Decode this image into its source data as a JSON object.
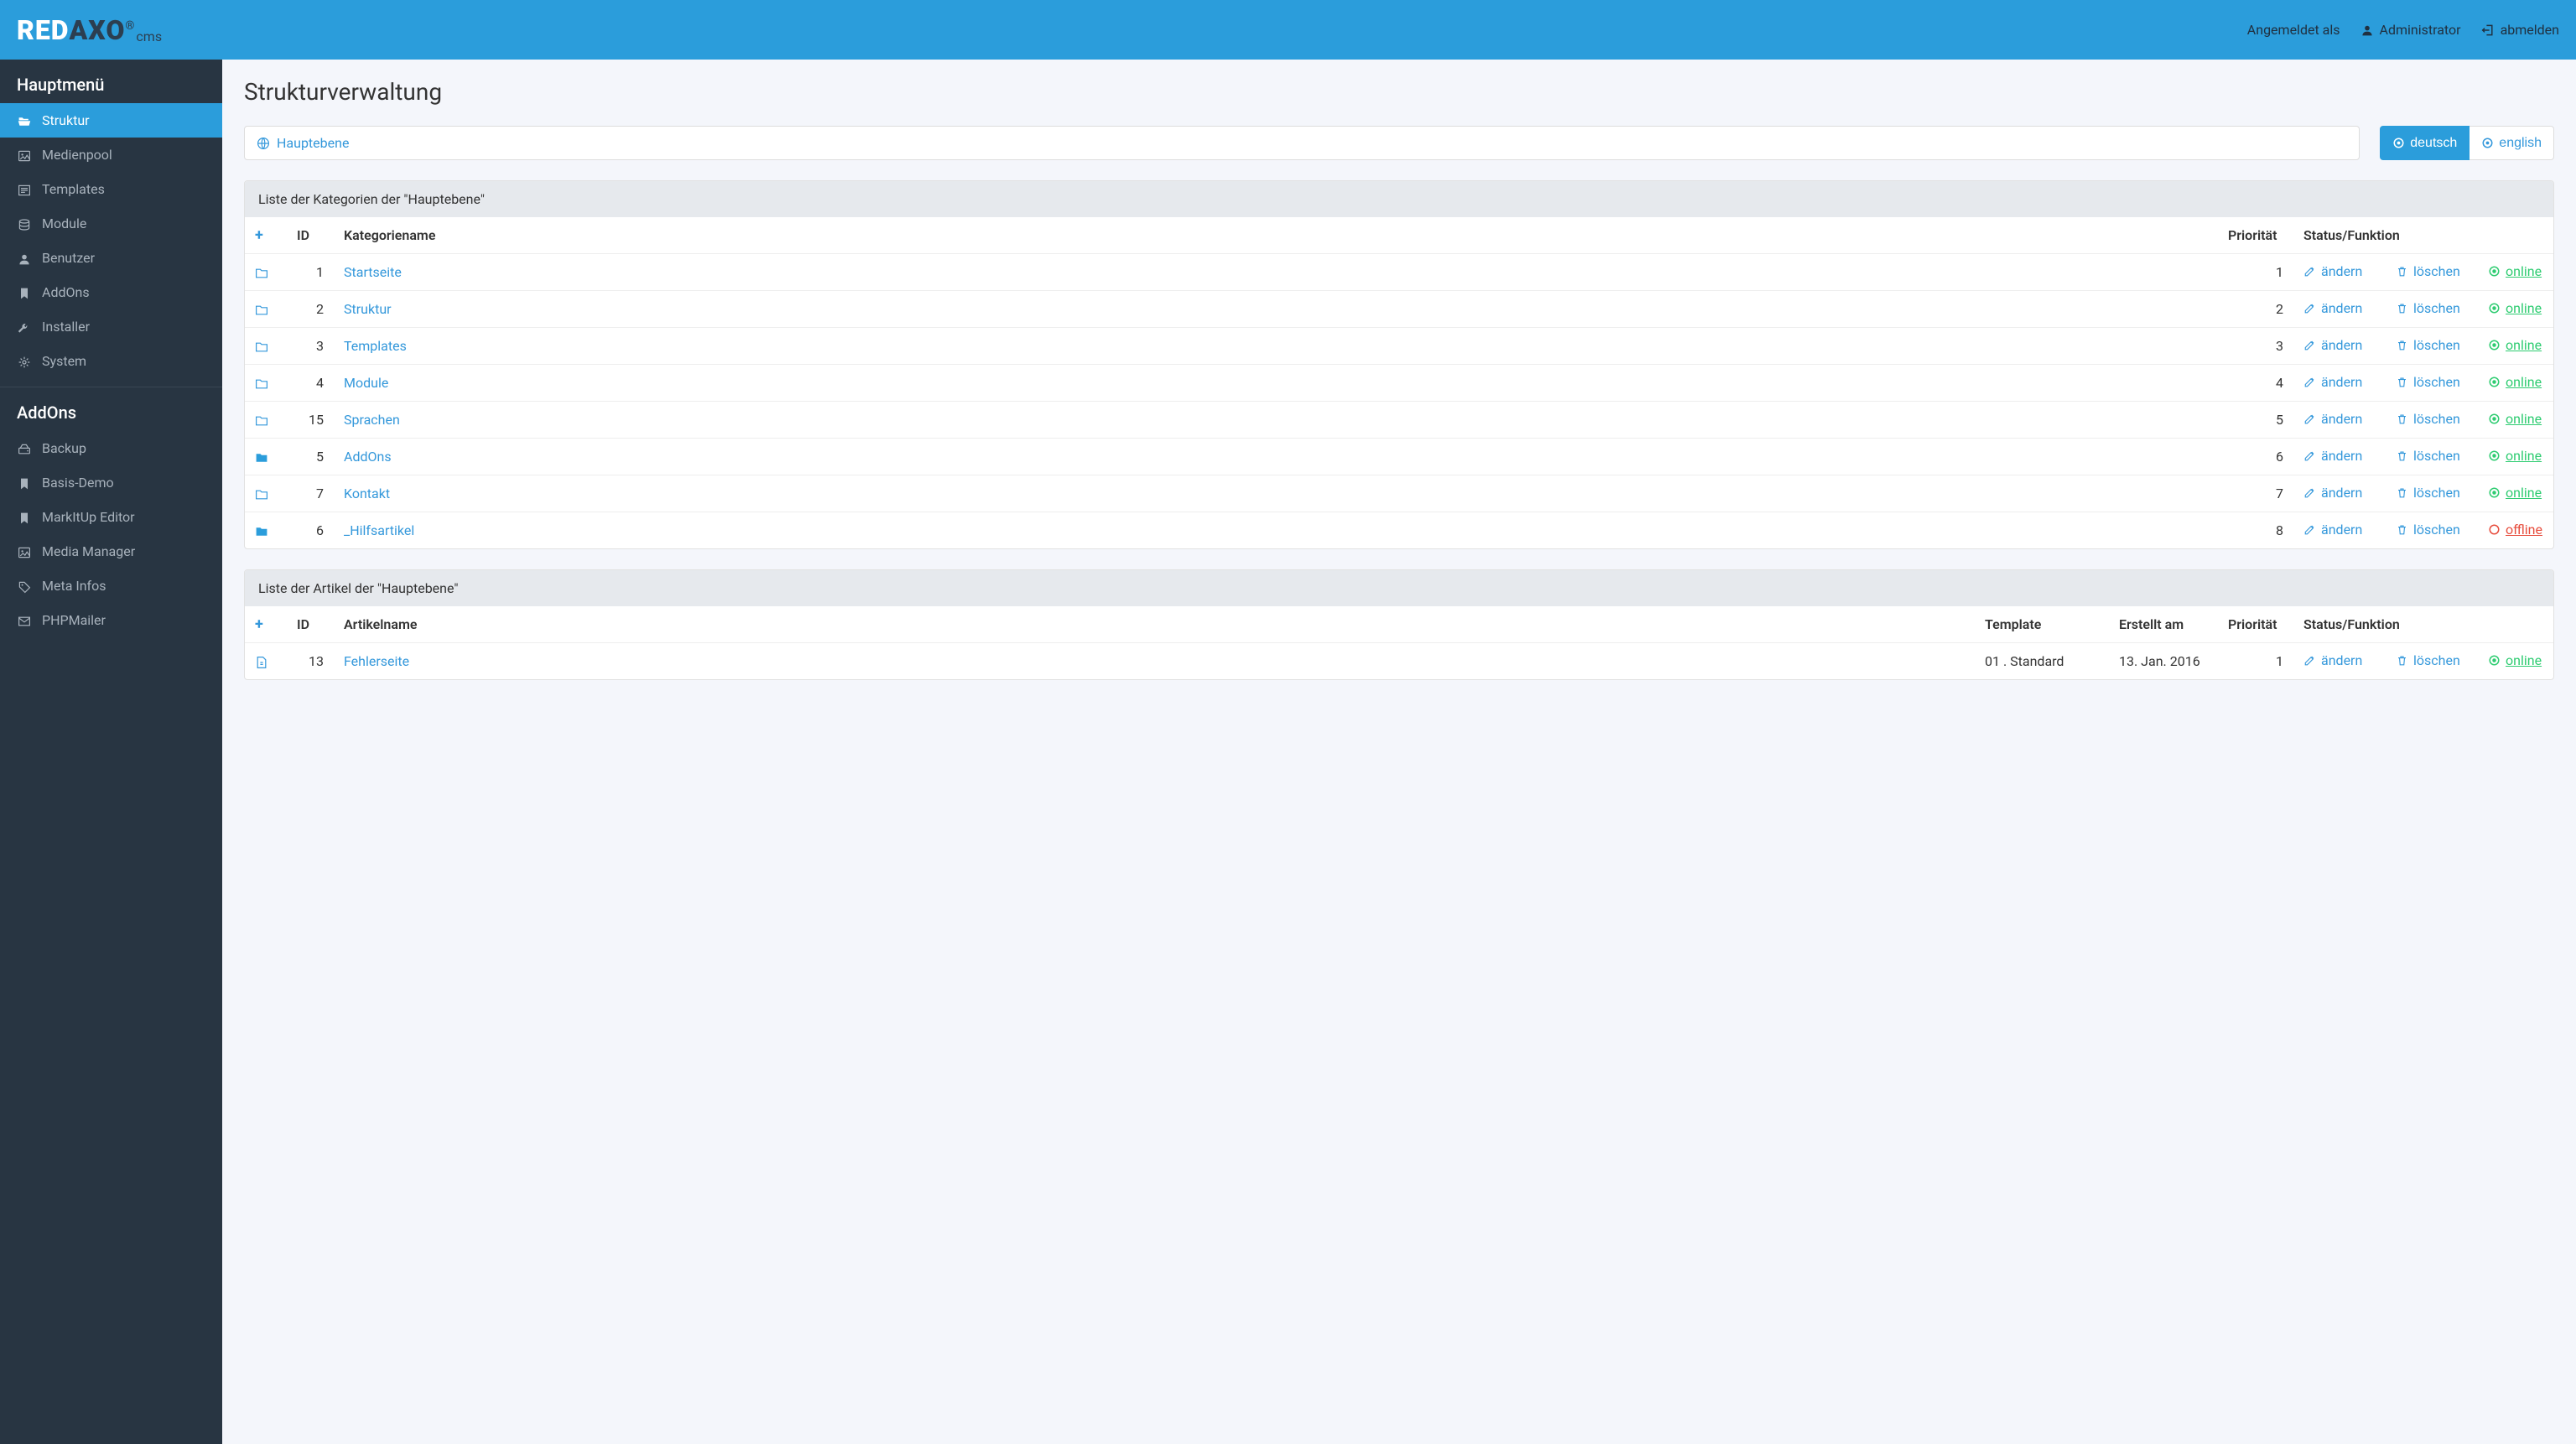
{
  "header": {
    "loggedInAs": "Angemeldet als",
    "user": "Administrator",
    "logout": "abmelden"
  },
  "sidebar": {
    "mainTitle": "Hauptmenü",
    "addonsTitle": "AddOns",
    "mainItems": [
      {
        "label": "Struktur",
        "icon": "folder-open",
        "active": true
      },
      {
        "label": "Medienpool",
        "icon": "image"
      },
      {
        "label": "Templates",
        "icon": "newspaper"
      },
      {
        "label": "Module",
        "icon": "database"
      },
      {
        "label": "Benutzer",
        "icon": "user"
      },
      {
        "label": "AddOns",
        "icon": "bookmark"
      },
      {
        "label": "Installer",
        "icon": "wrench"
      },
      {
        "label": "System",
        "icon": "cogs"
      }
    ],
    "addonItems": [
      {
        "label": "Backup",
        "icon": "hdd"
      },
      {
        "label": "Basis-Demo",
        "icon": "bookmark"
      },
      {
        "label": "MarkItUp Editor",
        "icon": "bookmark"
      },
      {
        "label": "Media Manager",
        "icon": "image"
      },
      {
        "label": "Meta Infos",
        "icon": "tag"
      },
      {
        "label": "PHPMailer",
        "icon": "envelope"
      }
    ]
  },
  "page": {
    "title": "Strukturverwaltung",
    "breadcrumb": "Hauptebene",
    "langs": [
      {
        "label": "deutsch",
        "active": true
      },
      {
        "label": "english",
        "active": false
      }
    ]
  },
  "categories": {
    "panelTitle": "Liste der Kategorien der \"Hauptebene\"",
    "headers": {
      "id": "ID",
      "name": "Kategoriename",
      "prio": "Priorität",
      "status": "Status/Funktion"
    },
    "actions": {
      "edit": "ändern",
      "delete": "löschen",
      "online": "online",
      "offline": "offline"
    },
    "rows": [
      {
        "id": 1,
        "name": "Startseite",
        "prio": 1,
        "status": "online",
        "solid": false
      },
      {
        "id": 2,
        "name": "Struktur",
        "prio": 2,
        "status": "online",
        "solid": false
      },
      {
        "id": 3,
        "name": "Templates",
        "prio": 3,
        "status": "online",
        "solid": false
      },
      {
        "id": 4,
        "name": "Module",
        "prio": 4,
        "status": "online",
        "solid": false
      },
      {
        "id": 15,
        "name": "Sprachen",
        "prio": 5,
        "status": "online",
        "solid": false
      },
      {
        "id": 5,
        "name": "AddOns",
        "prio": 6,
        "status": "online",
        "solid": true
      },
      {
        "id": 7,
        "name": "Kontakt",
        "prio": 7,
        "status": "online",
        "solid": false
      },
      {
        "id": 6,
        "name": "_Hilfsartikel",
        "prio": 8,
        "status": "offline",
        "solid": true
      }
    ]
  },
  "articles": {
    "panelTitle": "Liste der Artikel der \"Hauptebene\"",
    "headers": {
      "id": "ID",
      "name": "Artikelname",
      "template": "Template",
      "created": "Erstellt am",
      "prio": "Priorität",
      "status": "Status/Funktion"
    },
    "actions": {
      "edit": "ändern",
      "delete": "löschen",
      "online": "online"
    },
    "rows": [
      {
        "id": 13,
        "name": "Fehlerseite",
        "template": "01 . Standard",
        "created": "13. Jan. 2016",
        "prio": 1,
        "status": "online"
      }
    ]
  }
}
